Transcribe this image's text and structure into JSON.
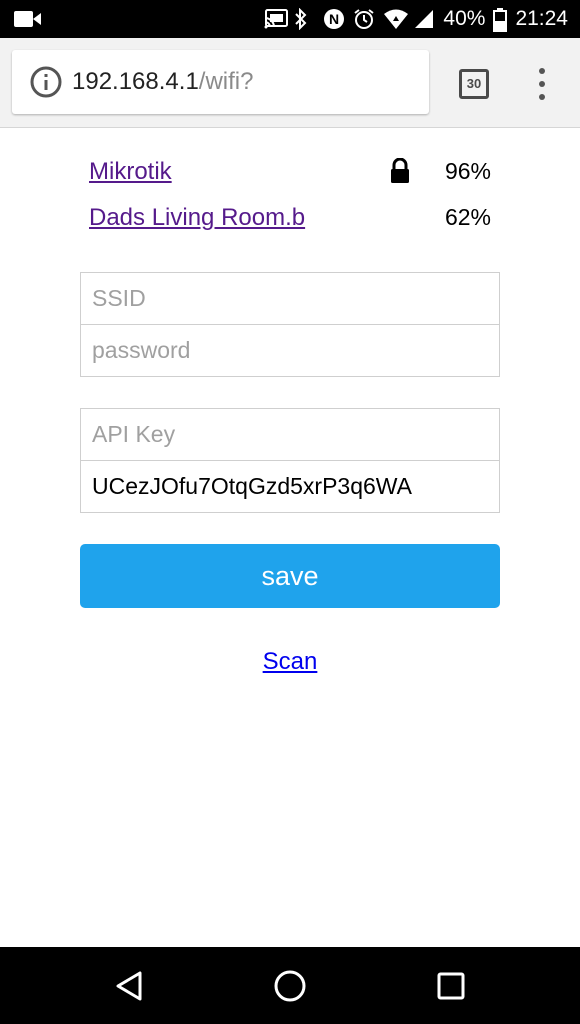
{
  "status_bar": {
    "battery": "40%",
    "time": "21:24",
    "icons": [
      "video-camera-icon",
      "cast-icon",
      "bluetooth-icon",
      "nfc-icon",
      "alarm-icon",
      "wifi-icon",
      "cell-signal-icon",
      "battery-icon"
    ]
  },
  "browser": {
    "url_host": "192.168.4.1",
    "url_path": "/wifi?",
    "tab_count": "30"
  },
  "networks": [
    {
      "ssid": "Mikrotik",
      "secured": true,
      "signal": "96%"
    },
    {
      "ssid": "Dads Living Room.b",
      "secured": false,
      "signal": "62%"
    }
  ],
  "form": {
    "ssid_placeholder": "SSID",
    "password_placeholder": "password",
    "api_key_placeholder": "API Key",
    "api_key_value": "UCezJOfu7OtqGzd5xrP3q6WA",
    "save_label": "save",
    "scan_label": "Scan"
  },
  "colors": {
    "button": "#1fa3ec",
    "visited_link": "#551a8b",
    "link": "#0000ee"
  }
}
